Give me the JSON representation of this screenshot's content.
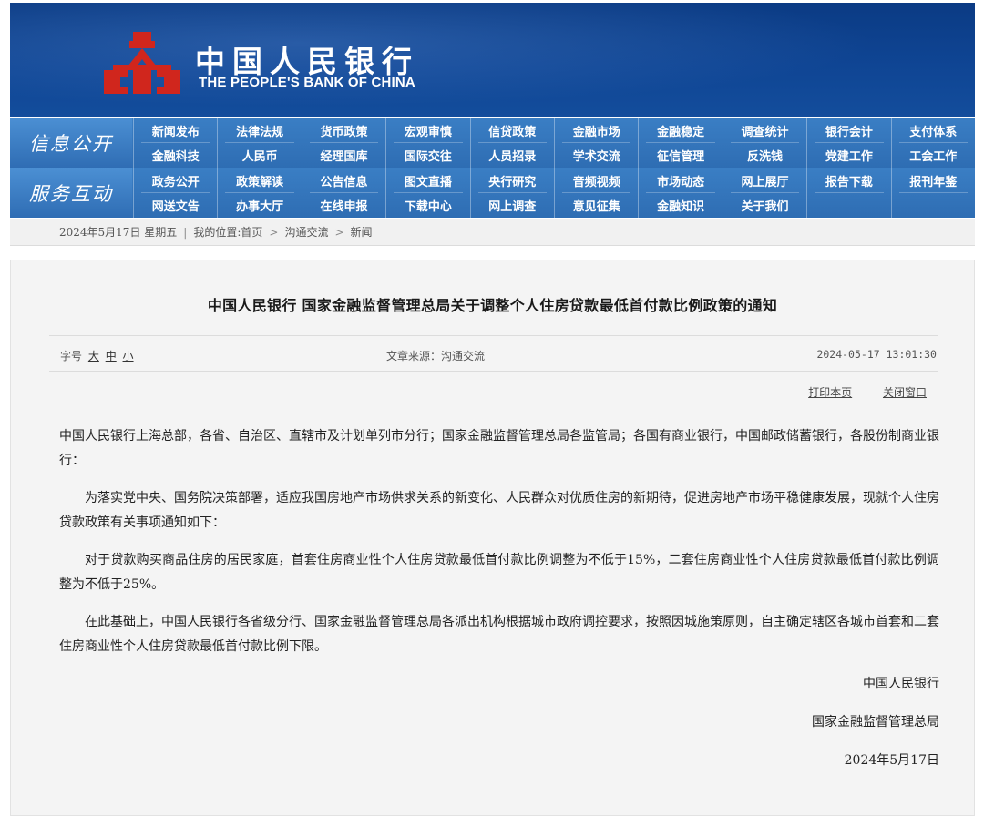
{
  "header": {
    "name_cn": "中国人民银行",
    "name_en": "THE PEOPLE'S BANK OF CHINA",
    "colors": {
      "banner": "#0f4594",
      "nav": "#2e6db3",
      "emblem": "#d0261d"
    }
  },
  "nav": {
    "info": {
      "label": "信息公开",
      "items": [
        "新闻发布",
        "法律法规",
        "货币政策",
        "宏观审慎",
        "信贷政策",
        "金融市场",
        "金融稳定",
        "调查统计",
        "银行会计",
        "支付体系",
        "金融科技",
        "人民币",
        "经理国库",
        "国际交往",
        "人员招录",
        "学术交流",
        "征信管理",
        "反洗钱",
        "党建工作",
        "工会工作"
      ]
    },
    "service": {
      "label": "服务互动",
      "items": [
        "政务公开",
        "政策解读",
        "公告信息",
        "图文直播",
        "央行研究",
        "音频视频",
        "市场动态",
        "网上展厅",
        "报告下载",
        "报刊年鉴",
        "网送文告",
        "办事大厅",
        "在线申报",
        "下载中心",
        "网上调查",
        "意见征集",
        "金融知识",
        "关于我们",
        "",
        ""
      ]
    }
  },
  "breadcrumb": {
    "date": "2024年5月17日  星期五",
    "location_label": "我的位置:",
    "home": "首页",
    "section": "沟通交流",
    "current": "新闻"
  },
  "article": {
    "title": "中国人民银行  国家金融监督管理总局关于调整个人住房贷款最低首付款比例政策的通知",
    "font_label": "字号",
    "font_large": "大",
    "font_medium": "中",
    "font_small": "小",
    "source": "文章来源：沟通交流",
    "time": "2024-05-17  13:01:30",
    "print_label": "打印本页",
    "close_label": "关闭窗口",
    "paragraphs": [
      "中国人民银行上海总部，各省、自治区、直辖市及计划单列市分行；国家金融监督管理总局各监管局；各国有商业银行，中国邮政储蓄银行，各股份制商业银行：",
      "为落实党中央、国务院决策部署，适应我国房地产市场供求关系的新变化、人民群众对优质住房的新期待，促进房地产市场平稳健康发展，现就个人住房贷款政策有关事项通知如下：",
      "对于贷款购买商品住房的居民家庭，首套住房商业性个人住房贷款最低首付款比例调整为不低于15%，二套住房商业性个人住房贷款最低首付款比例调整为不低于25%。",
      "在此基础上，中国人民银行各省级分行、国家金融监督管理总局各派出机构根据城市政府调控要求，按照因城施策原则，自主确定辖区各城市首套和二套住房商业性个人住房贷款最低首付款比例下限。"
    ],
    "signatures": [
      "中国人民银行",
      "国家金融监督管理总局",
      "2024年5月17日"
    ]
  }
}
